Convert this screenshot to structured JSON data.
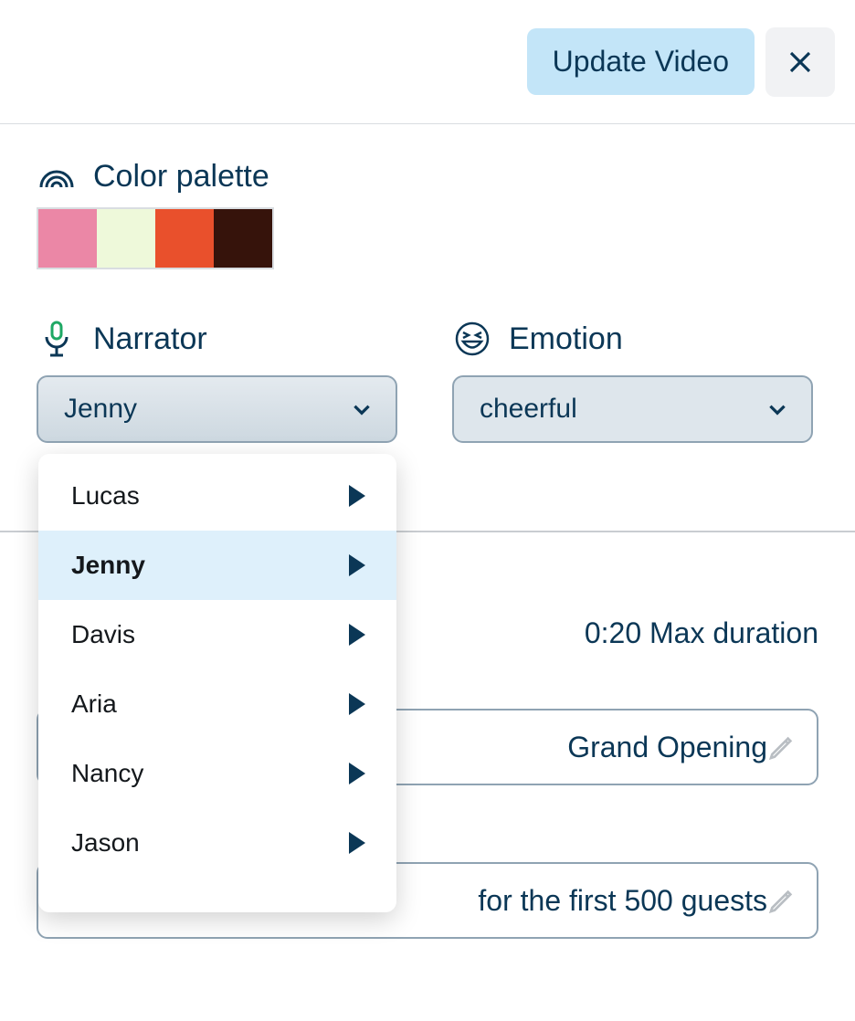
{
  "header": {
    "update_button": "Update Video"
  },
  "palette": {
    "title": "Color palette",
    "colors": [
      "#eb87a6",
      "#eef9da",
      "#e9502c",
      "#36130b"
    ]
  },
  "narrator": {
    "title": "Narrator",
    "selected": "Jenny",
    "options": [
      "Lucas",
      "Jenny",
      "Davis",
      "Aria",
      "Nancy",
      "Jason"
    ]
  },
  "emotion": {
    "title": "Emotion",
    "selected": "cheerful"
  },
  "duration": {
    "text": "0:20 Max duration"
  },
  "fields": [
    {
      "text": "Grand Opening"
    },
    {
      "text": "for the first 500 guests"
    }
  ]
}
